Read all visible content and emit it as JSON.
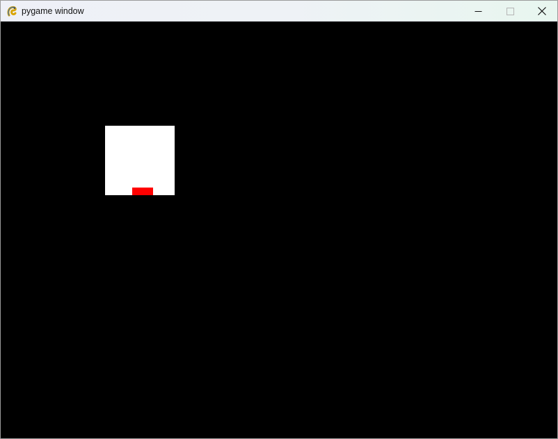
{
  "window": {
    "title": "pygame window",
    "app_icon": "pygame-snake-icon"
  },
  "titlebar_controls": {
    "minimize_icon": "minimize-icon",
    "maximize_icon": "maximize-icon",
    "close_icon": "close-icon"
  },
  "colors": {
    "surface_background": "#000000",
    "box": "#ffffff",
    "paddle": "#ff0000"
  }
}
